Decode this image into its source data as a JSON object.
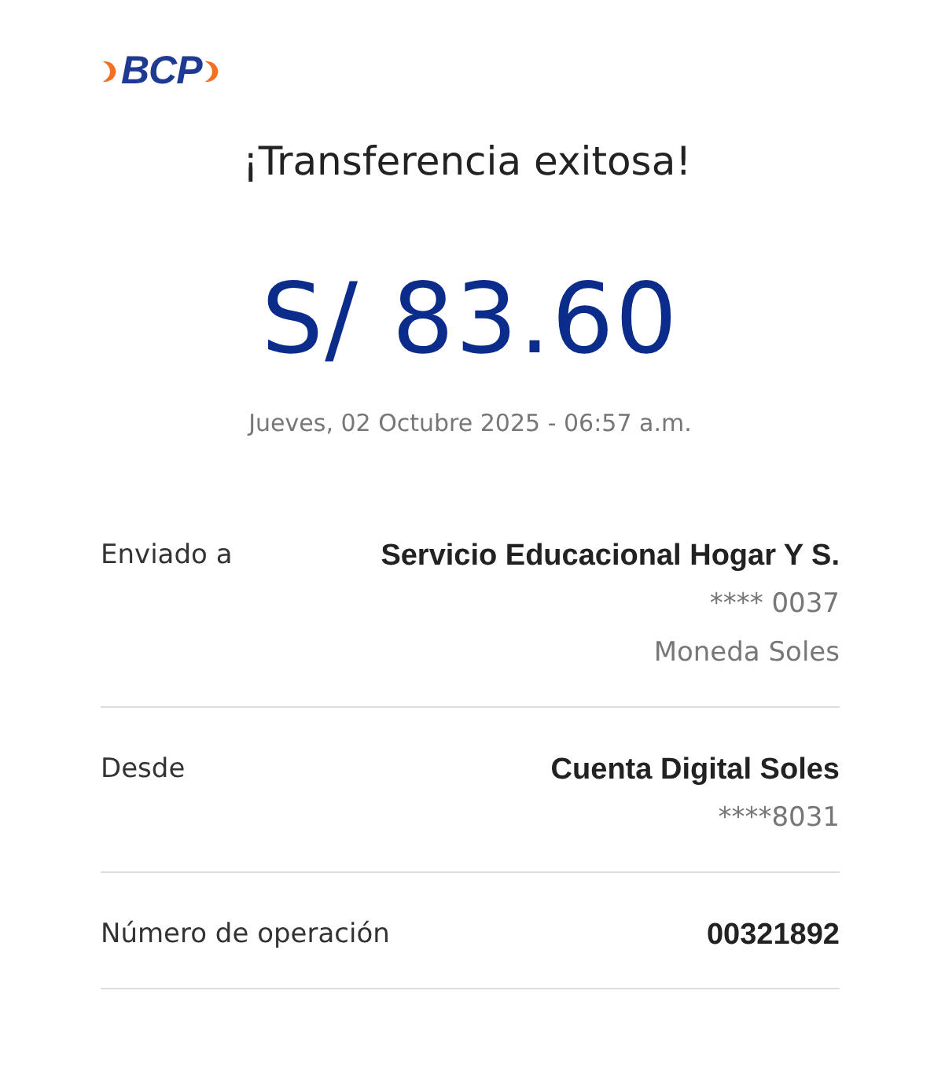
{
  "logo": {
    "text": "BCP"
  },
  "title": "¡Transferencia exitosa!",
  "amount": "S/ 83.60",
  "datetime": "Jueves, 02 Octubre 2025 - 06:57 a.m.",
  "details": [
    {
      "label": "Enviado a",
      "values": [
        {
          "text": "Servicio Educacional Hogar Y S.",
          "kind": "primary"
        },
        {
          "text": "**** 0037",
          "kind": "secondary"
        },
        {
          "text": "Moneda Soles",
          "kind": "secondary"
        }
      ]
    },
    {
      "label": "Desde",
      "values": [
        {
          "text": "Cuenta Digital Soles",
          "kind": "primary"
        },
        {
          "text": "****8031",
          "kind": "secondary"
        }
      ]
    },
    {
      "label": "Número de operación",
      "values": [
        {
          "text": "00321892",
          "kind": "primary"
        }
      ]
    }
  ]
}
